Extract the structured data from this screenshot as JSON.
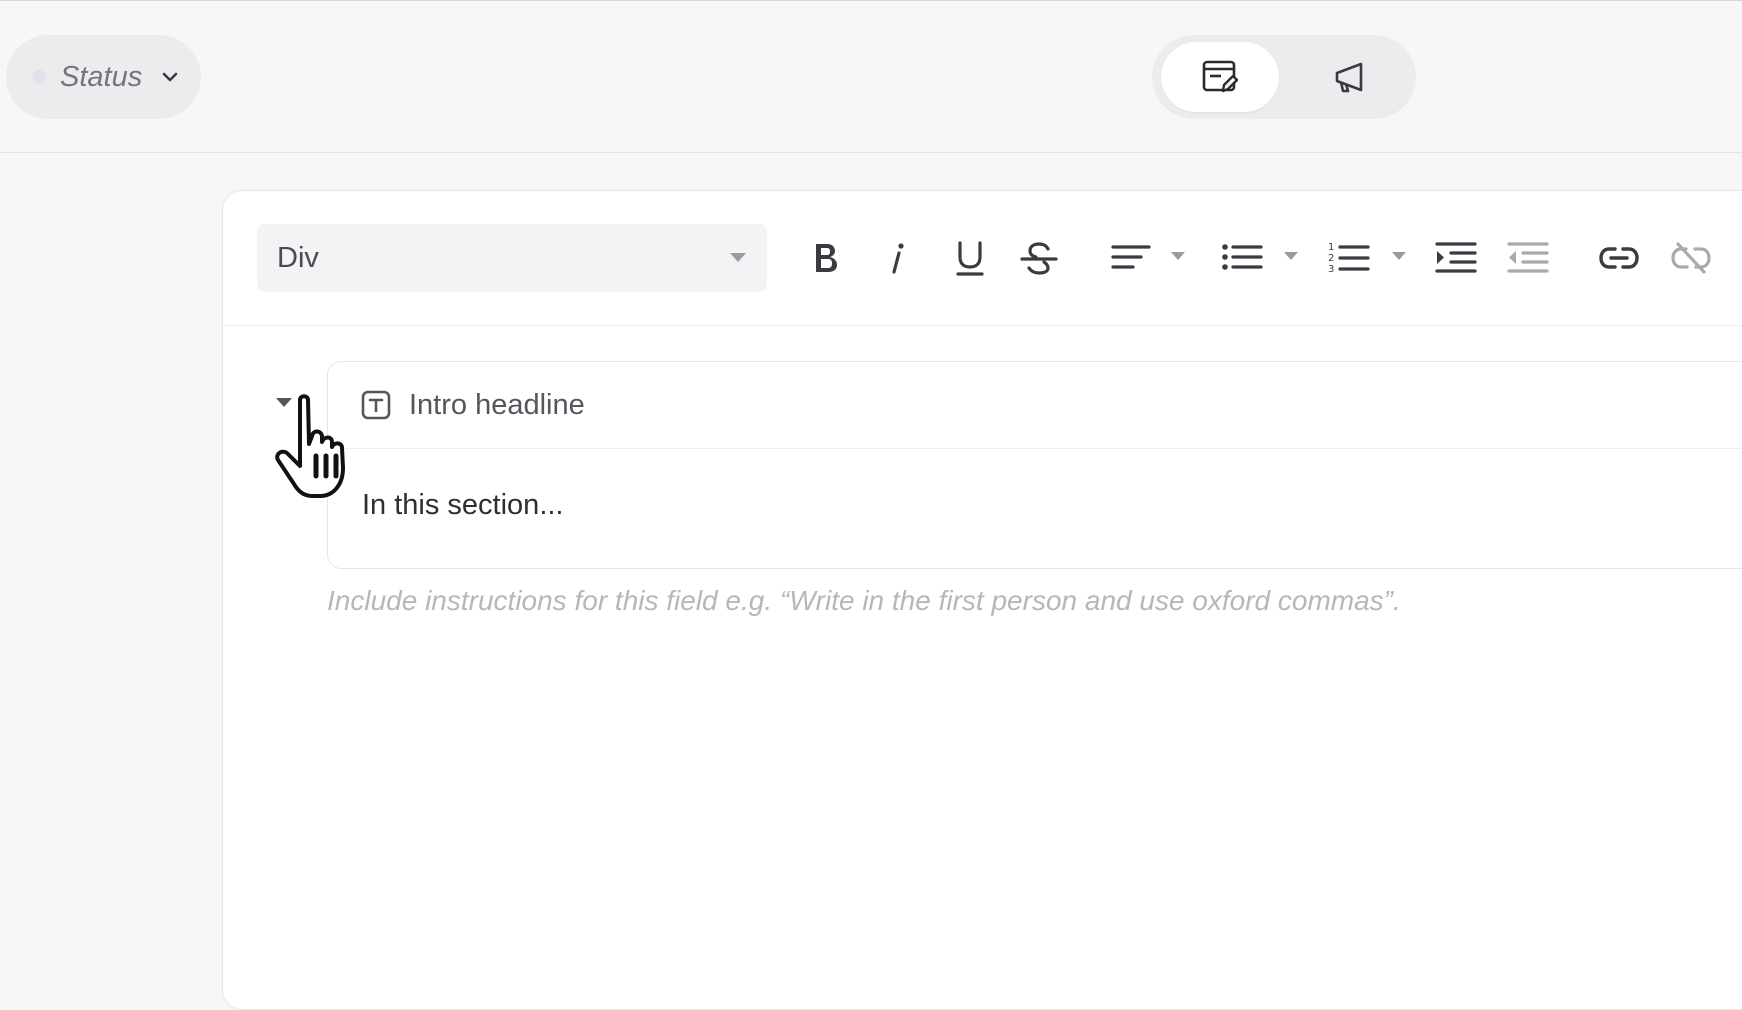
{
  "topbar": {
    "status": {
      "label": "Status"
    },
    "view_toggle": {
      "active": "edit-form",
      "options": [
        {
          "icon": "edit-form-icon"
        },
        {
          "icon": "megaphone-icon"
        }
      ]
    }
  },
  "toolbar": {
    "block_format": {
      "value": "Div"
    },
    "tools": [
      {
        "icon": "bold-icon"
      },
      {
        "icon": "italic-icon"
      },
      {
        "icon": "underline-icon"
      },
      {
        "icon": "strikethrough-icon"
      },
      {
        "icon": "align-left-icon",
        "has_dropdown": true
      },
      {
        "icon": "bullet-list-icon",
        "has_dropdown": true
      },
      {
        "icon": "numbered-list-icon",
        "has_dropdown": true
      },
      {
        "icon": "indent-icon"
      },
      {
        "icon": "outdent-icon"
      },
      {
        "icon": "link-icon"
      },
      {
        "icon": "unlink-icon"
      }
    ]
  },
  "field": {
    "title": "Intro headline",
    "content": "In this section...",
    "hint": "Include instructions for this field e.g. “Write in the first person and use oxford commas”."
  },
  "colors": {
    "background": "#f7f7f8",
    "card": "#ffffff",
    "muted_text": "#b6b6bc",
    "icon": "#3a3a40",
    "icon_disabled": "#a9a9b0"
  }
}
